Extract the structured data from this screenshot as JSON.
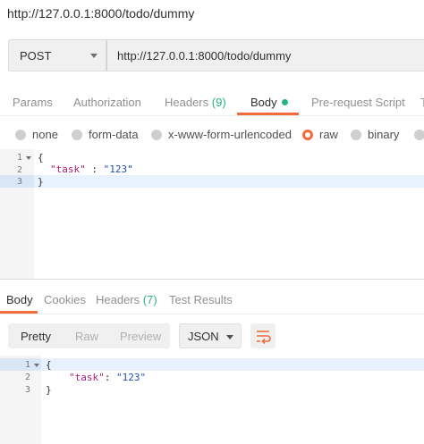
{
  "request": {
    "title": "http://127.0.0.1:8000/todo/dummy",
    "method": "POST",
    "url": "http://127.0.0.1:8000/todo/dummy",
    "tabs": {
      "params": "Params",
      "authorization": "Authorization",
      "headers": "Headers",
      "headers_count": "(9)",
      "body": "Body",
      "prerequest": "Pre-request Script",
      "tests_partial": "T"
    },
    "body_types": {
      "none": "none",
      "form_data": "form-data",
      "urlencoded": "x-www-form-urlencoded",
      "raw": "raw",
      "binary": "binary",
      "selected": "raw"
    },
    "editor": {
      "line_numbers": [
        "1",
        "2",
        "3"
      ],
      "line1": "{",
      "key": "\"task\"",
      "sep": " : ",
      "value": "\"123\"",
      "line3": "}"
    }
  },
  "response": {
    "tabs": {
      "body": "Body",
      "cookies": "Cookies",
      "headers": "Headers",
      "headers_count": "(7)",
      "test_results": "Test Results"
    },
    "view": {
      "pretty": "Pretty",
      "raw": "Raw",
      "preview": "Preview",
      "selected": "Pretty"
    },
    "format": "JSON",
    "editor": {
      "line_numbers": [
        "1",
        "2",
        "3"
      ],
      "line1": "{",
      "key": "\"task\"",
      "sep": ": ",
      "value": "\"123\"",
      "line3": "}"
    }
  },
  "colors": {
    "accent": "#f26b3a",
    "count_green": "#26b47f",
    "json_key": "#a31d70",
    "json_string": "#1f4fb5"
  },
  "icons": {
    "method_dropdown": "chevron-down-icon",
    "format_dropdown": "chevron-down-icon",
    "wrap": "wrap-lines-icon",
    "fold": "fold-arrow-icon"
  }
}
